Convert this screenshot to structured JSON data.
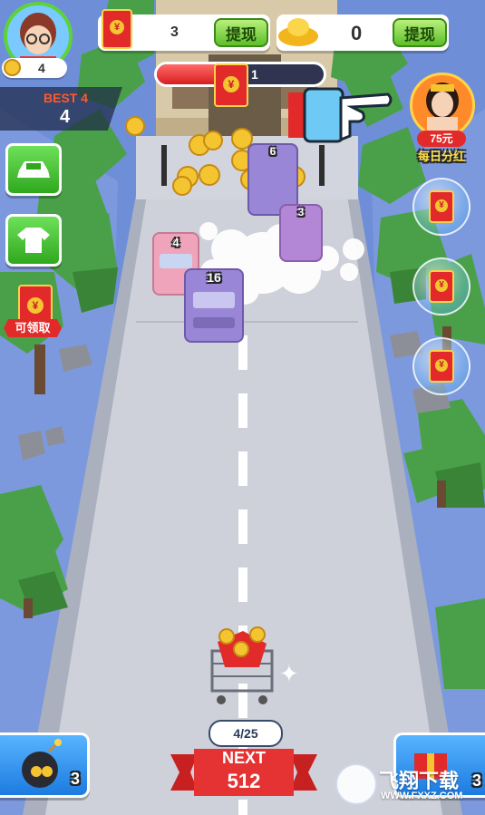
{
  "hud": {
    "coins": "4",
    "best_label": "BEST 4",
    "best_value": "4",
    "red_packet_count": "3",
    "red_withdraw": "提现",
    "gold_count": "0",
    "gold_withdraw": "提现",
    "progress_value": "1",
    "progress_fraction": 0.45
  },
  "side_left": {
    "red_packet_label": "可领取"
  },
  "side_right": {
    "promo_amount": "75元",
    "promo_label": "每日分红"
  },
  "cars": [
    {
      "number": "4",
      "color": "#f0a4bc"
    },
    {
      "number": "16",
      "color": "#9a86d6"
    },
    {
      "number": "6",
      "color": "#9a86d6"
    },
    {
      "number": "3",
      "color": "#b486d6"
    }
  ],
  "player": {
    "progress": "4/25"
  },
  "bottom": {
    "bomb_count": "3",
    "next_label": "NEXT",
    "next_value": "512",
    "right_count": "3",
    "watermark_cn": "飞翔下载",
    "watermark_url": "WWW.FXXZ.COM"
  },
  "colors": {
    "sky_water": "#6e8fd8",
    "road": "#c9ccd6",
    "tree": "#4aa048",
    "red": "#e22a2a",
    "green": "#3fbf2a"
  }
}
